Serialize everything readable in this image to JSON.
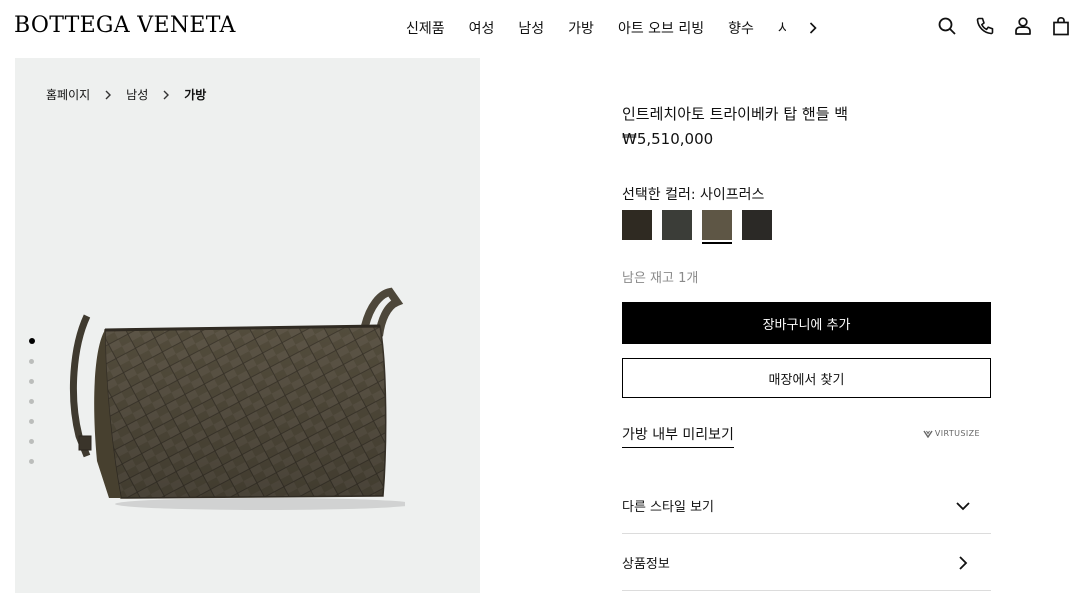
{
  "brand": {
    "logo_text": "BOTTEGA VENETA"
  },
  "nav": {
    "items": [
      "신제품",
      "여성",
      "남성",
      "가방",
      "아트 오브 리빙",
      "향수",
      "시"
    ],
    "next_icon": "chevron-right-icon"
  },
  "header_icons": [
    "search-icon",
    "phone-icon",
    "account-icon",
    "shopping-bag-icon"
  ],
  "breadcrumb": [
    "홈페이지",
    "남성",
    "가방"
  ],
  "gallery": {
    "image_count": 7,
    "active_index": 0,
    "image_alt": "product-bag-image"
  },
  "product": {
    "title": "인트레치아토 트라이베카 탑 핸들 백",
    "price": "₩5,510,000",
    "color_label": "선택한 컬러: 사이프러스",
    "swatches": [
      {
        "name": "swatch-1",
        "color": "#2f2a22",
        "selected": false
      },
      {
        "name": "swatch-2",
        "color": "#3b3d38",
        "selected": false
      },
      {
        "name": "swatch-3",
        "color": "#5e5645",
        "selected": true
      },
      {
        "name": "swatch-4",
        "color": "#2b2926",
        "selected": false
      }
    ],
    "stock": "남은 재고 1개",
    "add_to_cart": "장바구니에 추가",
    "find_in_store": "매장에서 찾기",
    "preview_link": "가방 내부 미리보기",
    "virtusize": "VIRTUSIZE"
  },
  "accordion": [
    {
      "label": "다른 스타일 보기",
      "icon": "chevron-down-icon"
    },
    {
      "label": "상품정보",
      "icon": "chevron-right-icon"
    }
  ]
}
